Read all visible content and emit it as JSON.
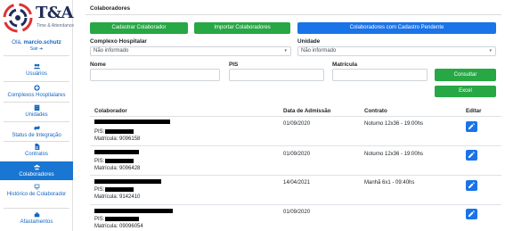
{
  "app": {
    "brand": "T&A",
    "tagline": "Time & Attendance"
  },
  "user": {
    "greeting_prefix": "Olá,",
    "username": "marcio.schutz",
    "lang_icon": "brazil-flag-icon",
    "lang_label": "Sair ➜"
  },
  "sidebar": {
    "items": [
      {
        "label": "Usuários",
        "icon": "users-icon"
      },
      {
        "label": "Complexos Hospitalares",
        "icon": "hospital-icon"
      },
      {
        "label": "Unidades",
        "icon": "building-icon"
      },
      {
        "label": "Status de Integração",
        "icon": "sync-icon"
      },
      {
        "label": "Contratos",
        "icon": "document-icon"
      },
      {
        "label": "Colaboradores",
        "icon": "group-icon",
        "active": true
      },
      {
        "label": "Histórico de Colaborador",
        "icon": "history-icon"
      },
      {
        "label": "Afastamentos",
        "icon": "leave-icon"
      }
    ]
  },
  "page": {
    "title": "Colaboradores"
  },
  "toolbar": {
    "cadastrar": "Cadastrar Colaborador",
    "importar": "Importar Colaboradores",
    "pendente": "Colaboradores com Cadastro Pendente"
  },
  "filters": {
    "complexo_label": "Complexo Hospitalar",
    "complexo_value": "Não informado",
    "unidade_label": "Unidade",
    "unidade_value": "Não informado",
    "nome_label": "Nome",
    "pis_label": "PIS",
    "matricula_label": "Matrícula",
    "consultar": "Consultar",
    "excel": "Excel"
  },
  "table": {
    "headers": {
      "colaborador": "Colaborador",
      "admissao": "Data de Admissão",
      "contrato": "Contrato",
      "editar": "Editar"
    },
    "rows": [
      {
        "pis_label": "PIS:",
        "matricula": "Matrícula: 9096158",
        "admissao": "01/09/2020",
        "contrato": "Noturno 12x36 - 19:00hs"
      },
      {
        "pis_label": "PIS:",
        "matricula": "Matrícula: 9096428",
        "admissao": "01/09/2020",
        "contrato": "Noturno 12x36 - 19:00hs"
      },
      {
        "pis_label": "PIS:",
        "matricula": "Matrícula: 9142410",
        "admissao": "14/04/2021",
        "contrato": "Manhã 6x1 - 09:40hs"
      },
      {
        "pis_label": "PIS:",
        "matricula": "Matrícula: 09096054",
        "admissao": "01/09/2020",
        "contrato": "Noturno 12x36 - 19:00hs"
      }
    ]
  },
  "colors": {
    "primary": "#1a73e8",
    "success": "#28a745",
    "sidebar_active": "#1976d2",
    "link": "#1565c0"
  }
}
